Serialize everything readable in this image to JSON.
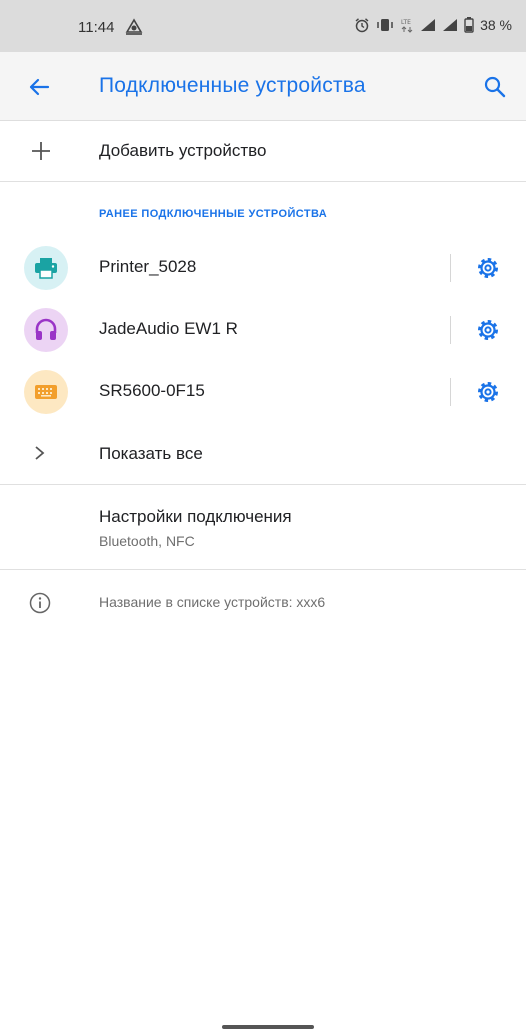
{
  "status_bar": {
    "time": "11:44",
    "battery_percent": "38 %",
    "icons": [
      "notification-icon",
      "alarm-icon",
      "vibrate-icon",
      "lte-icon",
      "signal-icon",
      "signal-icon",
      "battery-icon"
    ]
  },
  "app_bar": {
    "title": "Подключенные устройства",
    "back_icon": "arrow-left-icon",
    "search_icon": "search-icon"
  },
  "add_device": {
    "label": "Добавить устройство",
    "icon": "plus-icon"
  },
  "previously_connected": {
    "header": "РАНЕЕ ПОДКЛЮЧЕННЫЕ УСТРОЙСТВА",
    "devices": [
      {
        "name": "Printer_5028",
        "icon": "printer-icon",
        "color": "#1aa3a3",
        "bg": "#d7f1f4"
      },
      {
        "name": "JadeAudio EW1 R",
        "icon": "headphones-icon",
        "color": "#9a34c7",
        "bg": "#ecd4f4"
      },
      {
        "name": "SR5600-0F15",
        "icon": "keyboard-icon",
        "color": "#f29f2c",
        "bg": "#fde8c2"
      }
    ],
    "settings_icon": "gear-icon"
  },
  "show_all": {
    "label": "Показать все",
    "icon": "chevron-right-icon"
  },
  "connection_settings": {
    "title": "Настройки подключения",
    "subtitle": "Bluetooth, NFC"
  },
  "device_name_info": {
    "text": "Название в списке устройств: ххх6",
    "icon": "info-icon"
  },
  "colors": {
    "accent": "#1a73e8",
    "status_bar_bg": "#dcdcdc",
    "app_bar_bg": "#f5f5f5"
  }
}
